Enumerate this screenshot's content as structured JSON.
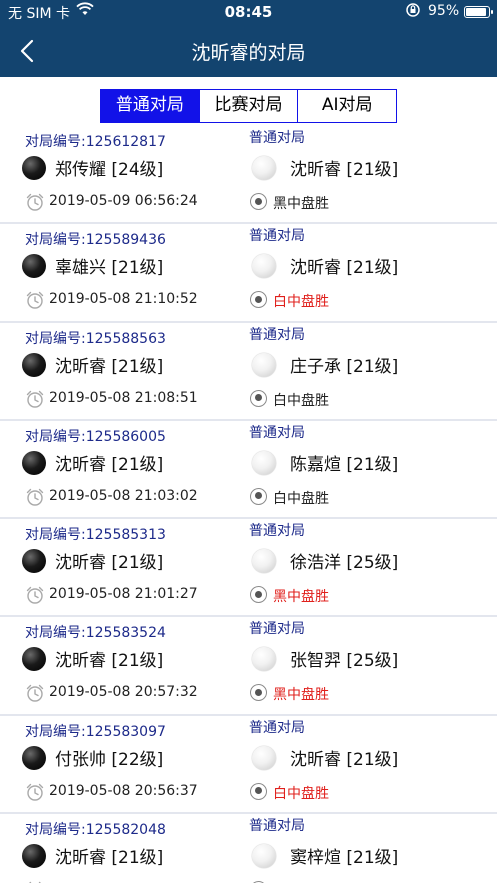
{
  "status_bar": {
    "carrier": "无 SIM 卡",
    "time": "08:45",
    "battery_percent_label": "95%",
    "battery_level": 0.95,
    "wifi_icon": "wifi-icon",
    "lock_icon": "rotation-lock-icon"
  },
  "nav": {
    "title": "沈昕睿的对局",
    "back_icon": "chevron-left-icon"
  },
  "tabs": [
    {
      "label": "普通对局",
      "active": true
    },
    {
      "label": "比赛对局",
      "active": false
    },
    {
      "label": "AI对局",
      "active": false
    }
  ],
  "colors": {
    "header": "#13446f",
    "tab_accent": "#1212e8",
    "id_text": "#1d2a8a",
    "result_red": "#e0201c",
    "result_black": "#222222"
  },
  "games": [
    {
      "id_label": "对局编号:125612817",
      "type": "普通对局",
      "black": "郑传耀 [24级]",
      "white": "沈昕睿 [21级]",
      "datetime": "2019-05-09 06:56:24",
      "result": "黑中盘胜",
      "result_color": "#222222"
    },
    {
      "id_label": "对局编号:125589436",
      "type": "普通对局",
      "black": "辜雄兴 [21级]",
      "white": "沈昕睿 [21级]",
      "datetime": "2019-05-08 21:10:52",
      "result": "白中盘胜",
      "result_color": "#e0201c"
    },
    {
      "id_label": "对局编号:125588563",
      "type": "普通对局",
      "black": "沈昕睿 [21级]",
      "white": "庄子承 [21级]",
      "datetime": "2019-05-08 21:08:51",
      "result": "白中盘胜",
      "result_color": "#222222"
    },
    {
      "id_label": "对局编号:125586005",
      "type": "普通对局",
      "black": "沈昕睿 [21级]",
      "white": "陈嘉煊 [21级]",
      "datetime": "2019-05-08 21:03:02",
      "result": "白中盘胜",
      "result_color": "#222222"
    },
    {
      "id_label": "对局编号:125585313",
      "type": "普通对局",
      "black": "沈昕睿 [21级]",
      "white": "徐浩洋 [25级]",
      "datetime": "2019-05-08 21:01:27",
      "result": "黑中盘胜",
      "result_color": "#e0201c"
    },
    {
      "id_label": "对局编号:125583524",
      "type": "普通对局",
      "black": "沈昕睿 [21级]",
      "white": "张智羿 [25级]",
      "datetime": "2019-05-08 20:57:32",
      "result": "黑中盘胜",
      "result_color": "#e0201c"
    },
    {
      "id_label": "对局编号:125583097",
      "type": "普通对局",
      "black": "付张帅 [22级]",
      "white": "沈昕睿 [21级]",
      "datetime": "2019-05-08 20:56:37",
      "result": "白中盘胜",
      "result_color": "#e0201c"
    },
    {
      "id_label": "对局编号:125582048",
      "type": "普通对局",
      "black": "沈昕睿 [21级]",
      "white": "窦梓煊 [21级]",
      "datetime": "",
      "result": "",
      "result_color": "#222222"
    }
  ]
}
